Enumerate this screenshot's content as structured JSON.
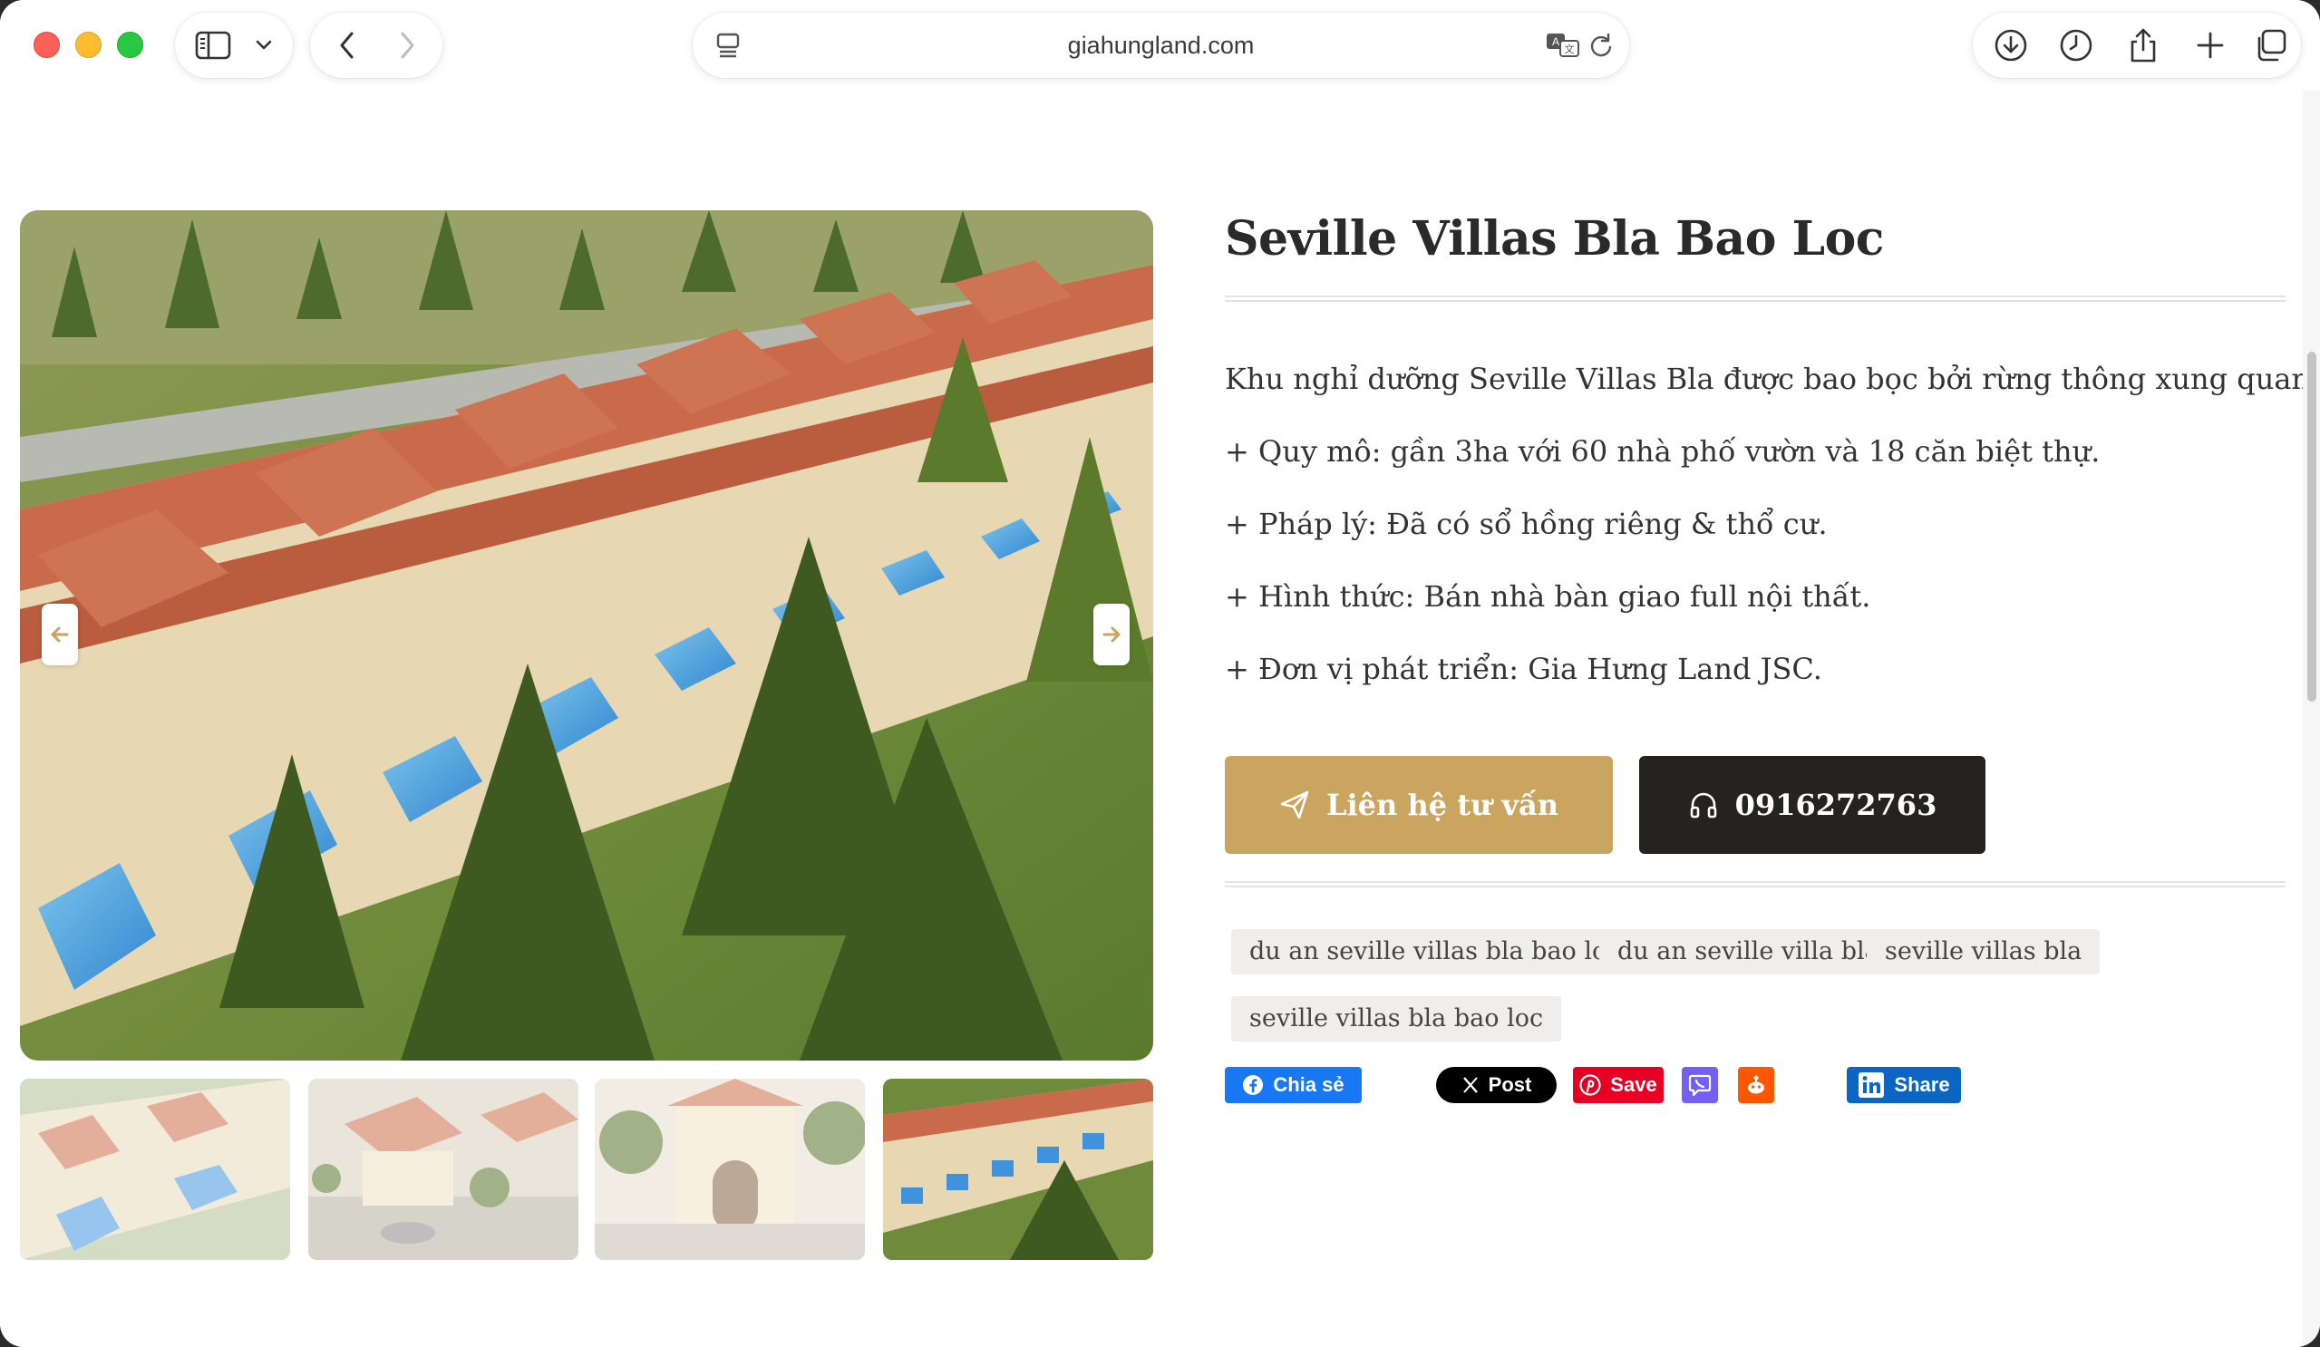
{
  "browser": {
    "url": "giahungland.com"
  },
  "product": {
    "title": "Seville Villas Bla Bao Loc",
    "description": [
      "Khu nghỉ dưỡng Seville Villas Bla được bao bọc bởi rừng thông xung quanh.",
      "+ Quy mô: gần 3ha với 60 nhà phố vườn và 18 căn biệt thự.",
      "+ Pháp lý: Đã có sổ hồng riêng & thổ cư.",
      "+ Hình thức: Bán nhà bàn giao full nội thất.",
      "+ Đơn vị phát triển: Gia Hưng Land JSC."
    ],
    "contact_button": "Liên hệ tư vấn",
    "phone_button": "0916272763",
    "tags": [
      "du an seville villas bla bao loc",
      "du an seville villa bla",
      "seville villas bla",
      "seville villas bla bao loc"
    ]
  },
  "share": {
    "facebook": "Chia sẻ",
    "x": "Post",
    "pinterest": "Save",
    "linkedin": "Share"
  },
  "gallery": {
    "selected_thumbnail": 4,
    "thumbnail_count": 4
  },
  "colors": {
    "accent_gold": "#c9a55f",
    "dark_button": "#252320",
    "facebook": "#1877f2",
    "pinterest": "#e60023",
    "viber": "#7360f2",
    "reddit": "#ff5700",
    "linkedin": "#0a66c2"
  }
}
